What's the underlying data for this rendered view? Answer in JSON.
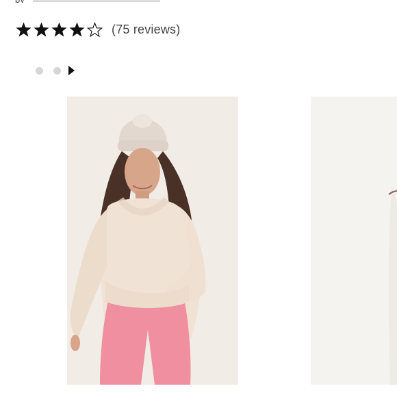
{
  "brand_line": {
    "prefix": "by"
  },
  "rating": {
    "stars": 4,
    "max_stars": 5,
    "reviews_text": "(75 reviews)"
  },
  "carousel": {
    "dots": 2,
    "next_icon": "triangle-right-icon"
  },
  "products": [
    {
      "name": "product-image-1",
      "description_colors": {
        "sweater": "#f0e2d4",
        "pants": "#ef8fa0",
        "hat": "#e4d9d1",
        "background": "#f1ece5"
      }
    },
    {
      "name": "product-image-2",
      "description_colors": {
        "background": "#f4f3f0"
      }
    }
  ],
  "icons": {
    "star_filled": "star-filled-icon",
    "star_empty": "star-outline-icon"
  }
}
